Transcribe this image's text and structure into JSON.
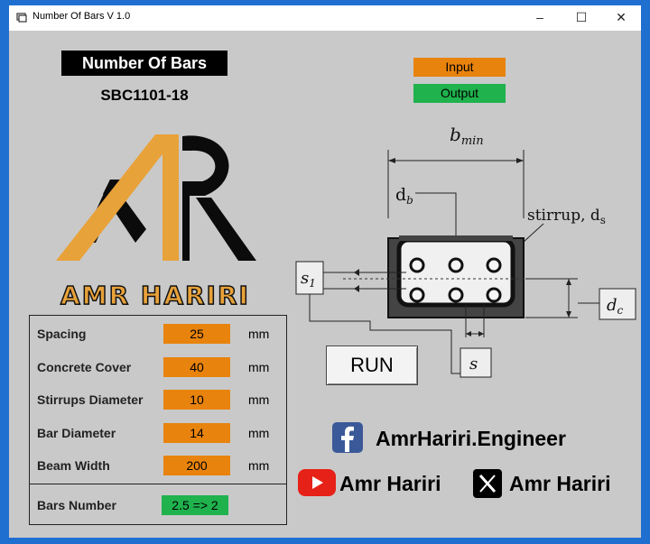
{
  "window": {
    "title": "Number Of Bars V 1.0",
    "minimize": "–",
    "maximize": "☐",
    "close": "✕"
  },
  "header": {
    "title": "Number Of Bars",
    "code": "SBC1101-18"
  },
  "legend": {
    "input_label": "Input",
    "output_label": "Output",
    "input_color": "#e8830d",
    "output_color": "#1fb24d"
  },
  "logo": {
    "text": "AMR HARIRI"
  },
  "inputs": [
    {
      "label": "Spacing",
      "value": "25",
      "unit": "mm"
    },
    {
      "label": "Concrete Cover",
      "value": "40",
      "unit": "mm"
    },
    {
      "label": "Stirrups Diameter",
      "value": "10",
      "unit": "mm"
    },
    {
      "label": "Bar Diameter",
      "value": "14",
      "unit": "mm"
    },
    {
      "label": "Beam Width",
      "value": "200",
      "unit": "mm"
    }
  ],
  "output": {
    "label": "Bars Number",
    "value": "2.5 => 2"
  },
  "diagram": {
    "bmin": "b",
    "bmin_sub": "min",
    "db": "d",
    "db_sub": "b",
    "stirrup": "stirrup, d",
    "stirrup_sub": "s",
    "s1": "s",
    "s1_sub": "1",
    "dc": "d",
    "dc_sub": "c",
    "s": "s"
  },
  "run_button": "RUN",
  "social": {
    "facebook": "AmrHariri.Engineer",
    "youtube": "Amr Hariri",
    "x": "Amr Hariri"
  }
}
